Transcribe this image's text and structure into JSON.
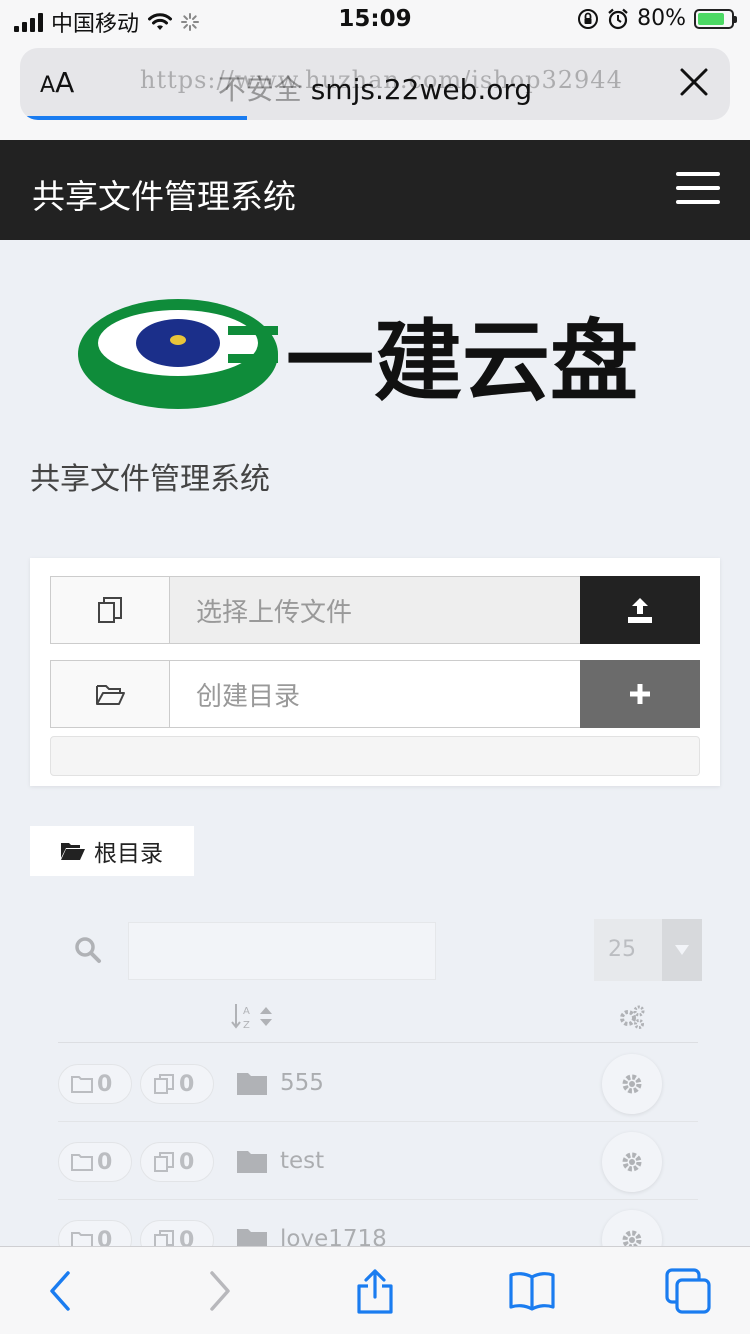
{
  "status_bar": {
    "carrier": "中国移动",
    "time": "15:09",
    "battery": "80%",
    "battery_level": 0.8
  },
  "browser": {
    "text_size_label": "AA",
    "url": "smjs.22web.org",
    "url_watermark": "https://www.huzhan.com/ishop32944",
    "not_secure": "不安全",
    "load_progress": 0.32
  },
  "navbar": {
    "brand": "共享文件管理系统"
  },
  "logo": {
    "text": "一建云盘",
    "colors": {
      "green": "#0f8c3a",
      "blue": "#1b2f8a",
      "yellow": "#e8c43a"
    }
  },
  "subtitle": "共享文件管理系统",
  "upload": {
    "file_placeholder": "选择上传文件",
    "dir_placeholder": "创建目录"
  },
  "breadcrumb": {
    "label": "根目录"
  },
  "table": {
    "page_size": "25",
    "rows": [
      {
        "folders": "0",
        "files": "0",
        "name": "555"
      },
      {
        "folders": "0",
        "files": "0",
        "name": "test"
      },
      {
        "folders": "0",
        "files": "0",
        "name": "love1718"
      }
    ]
  },
  "colors": {
    "navbar_bg": "#222222",
    "page_bg": "#edf0f5",
    "ios_blue": "#1a7cf0"
  }
}
